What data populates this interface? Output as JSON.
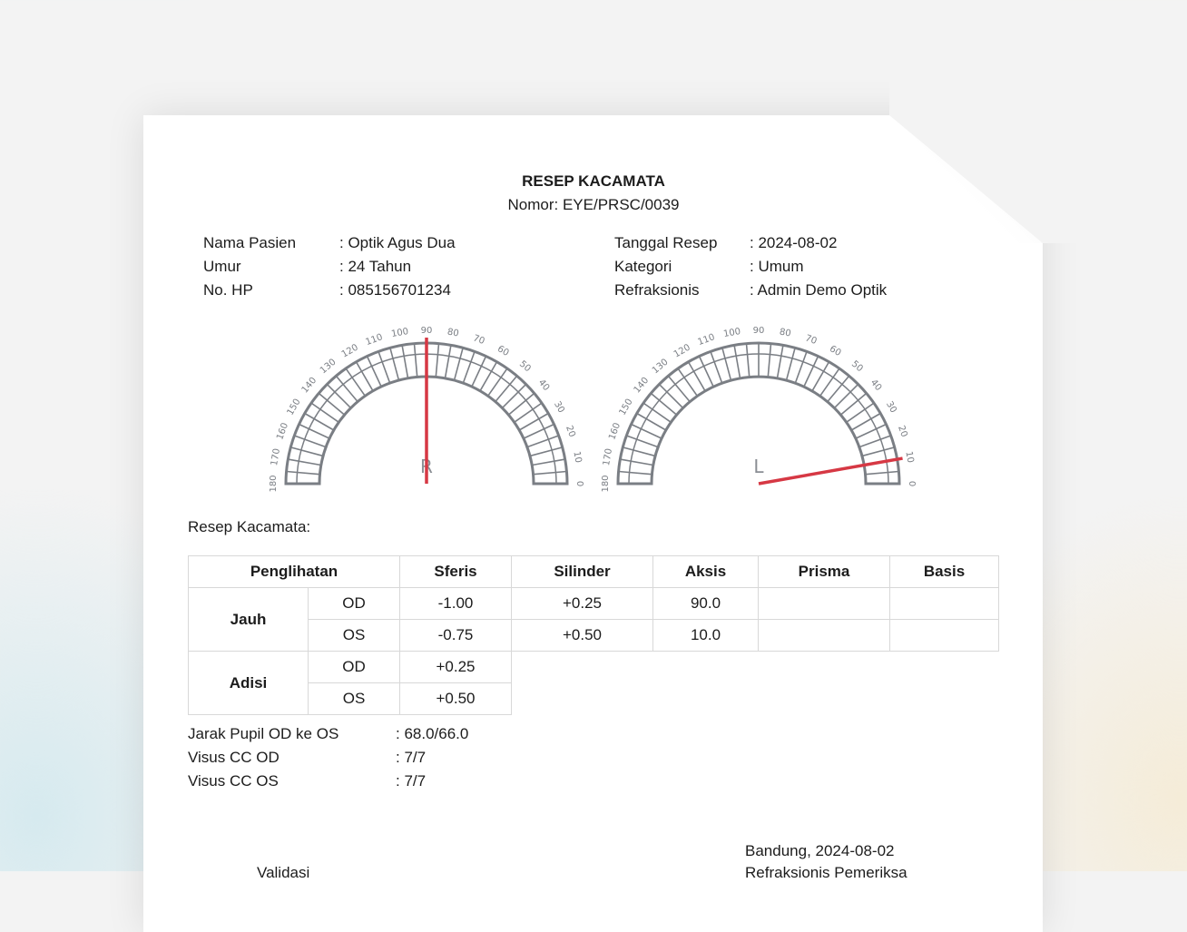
{
  "document": {
    "title": "RESEP KACAMATA",
    "number": "Nomor: EYE/PRSC/0039"
  },
  "patient": {
    "left": [
      {
        "label": "Nama Pasien",
        "value": ": Optik Agus Dua"
      },
      {
        "label": "Umur",
        "value": ": 24 Tahun"
      },
      {
        "label": "No. HP",
        "value": ": 085156701234"
      }
    ],
    "right": [
      {
        "label": "Tanggal Resep",
        "value": ": 2024-08-02"
      },
      {
        "label": "Kategori",
        "value": ": Umum"
      },
      {
        "label": "Refraksionis",
        "value": ": Admin Demo Optik"
      }
    ]
  },
  "dials": [
    {
      "eye_label": "R",
      "axis": 90.0,
      "ticks": [
        "180",
        "170",
        "160",
        "150",
        "140",
        "130",
        "120",
        "110",
        "100",
        "90",
        "80",
        "70",
        "60",
        "50",
        "40",
        "30",
        "20",
        "10",
        "0"
      ],
      "needle_color": "#d63844",
      "ring_color": "#7a7e84"
    },
    {
      "eye_label": "L",
      "axis": 10.0,
      "ticks": [
        "180",
        "170",
        "160",
        "150",
        "140",
        "130",
        "120",
        "110",
        "100",
        "90",
        "80",
        "70",
        "60",
        "50",
        "40",
        "30",
        "20",
        "10",
        "0"
      ],
      "needle_color": "#d63844",
      "ring_color": "#7a7e84"
    }
  ],
  "section_label": "Resep Kacamata:",
  "table": {
    "headers": [
      "Penglihatan",
      "Sferis",
      "Silinder",
      "Aksis",
      "Prisma",
      "Basis"
    ],
    "jauh": {
      "label": "Jauh",
      "rows": [
        {
          "eye": "OD",
          "sferis": "-1.00",
          "silinder": "+0.25",
          "aksis": "90.0",
          "prisma": "",
          "basis": ""
        },
        {
          "eye": "OS",
          "sferis": "-0.75",
          "silinder": "+0.50",
          "aksis": "10.0",
          "prisma": "",
          "basis": ""
        }
      ]
    },
    "adisi": {
      "label": "Adisi",
      "rows": [
        {
          "eye": "OD",
          "value": "+0.25"
        },
        {
          "eye": "OS",
          "value": "+0.50"
        }
      ]
    }
  },
  "extra": [
    {
      "label": "Jarak Pupil OD ke OS",
      "value": ": 68.0/66.0"
    },
    {
      "label": "Visus CC OD",
      "value": ": 7/7"
    },
    {
      "label": "Visus CC OS",
      "value": ": 7/7"
    }
  ],
  "footer": {
    "place_date": "Bandung, 2024-08-02",
    "left_sign_partial": "Validasi",
    "right_sign_partial": "Refraksionis Pemeriksa"
  }
}
